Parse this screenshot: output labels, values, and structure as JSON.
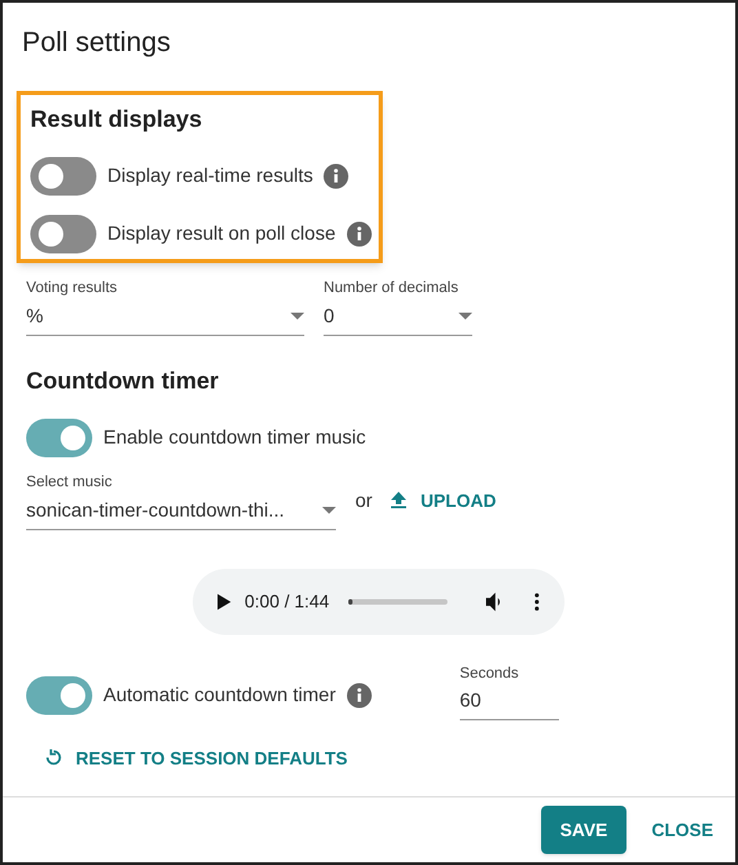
{
  "dialog": {
    "title": "Poll settings"
  },
  "result_displays": {
    "heading": "Result displays",
    "highlighted": true,
    "toggles": [
      {
        "label": "Display real-time results",
        "on": false,
        "info": true
      },
      {
        "label": "Display result on poll close",
        "on": false,
        "info": true
      }
    ]
  },
  "selects": [
    {
      "label": "Voting results",
      "value": "%"
    },
    {
      "label": "Number of decimals",
      "value": "0"
    }
  ],
  "countdown": {
    "heading": "Countdown timer",
    "music_toggle": {
      "label": "Enable countdown timer music",
      "on": true
    },
    "music_select": {
      "label": "Select music",
      "value": "sonican-timer-countdown-thi..."
    },
    "or_text": "or",
    "upload": "UPLOAD",
    "player": {
      "time": "0:00 / 1:44",
      "level": 0
    },
    "auto_toggle": {
      "label": "Automatic countdown timer",
      "on": true,
      "info": true
    },
    "seconds": {
      "label": "Seconds",
      "value": "60"
    },
    "reset": "RESET TO SESSION DEFAULTS"
  },
  "footer": {
    "buttons": [
      {
        "label": "SAVE",
        "kind": "primary"
      },
      {
        "label": "CLOSE",
        "kind": "text"
      }
    ]
  }
}
